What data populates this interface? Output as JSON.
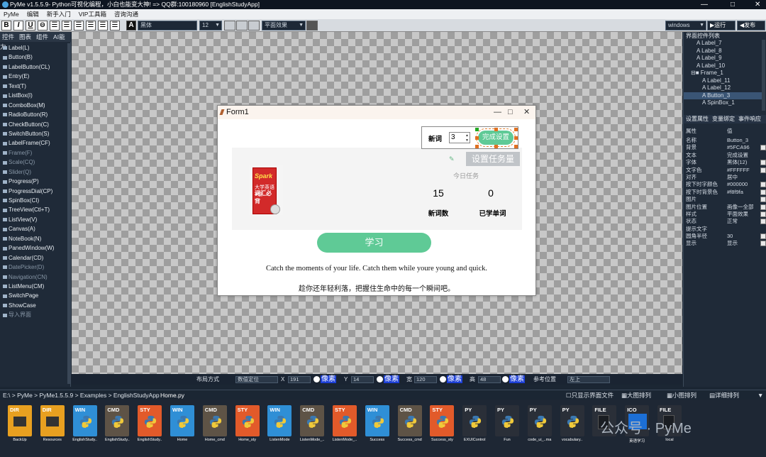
{
  "title_bar": {
    "text": "PyMe v1.5.5.9- Python可视化编程，小白也能变大神!  => QQ群:100180960    [EnglishStudyApp]"
  },
  "menu": [
    "PyMe",
    "编辑",
    "新手入门",
    "VIP工具箱",
    "咨询沟通"
  ],
  "toolbar": {
    "bold": "B",
    "italic": "I",
    "underline": "U",
    "font_color": "A",
    "font_name": "黑体",
    "font_size": "12",
    "effect": "平面效果",
    "platform": "windows",
    "run": "▶运行",
    "publish": "◀发布"
  },
  "left_panel": {
    "tabs": [
      "控件",
      "图表",
      "组件",
      "AI能力"
    ],
    "widgets": [
      "Label(L)",
      "Button(B)",
      "LabelButton(CL)",
      "Entry(E)",
      "Text(T)",
      "ListBox(I)",
      "ComboBox(M)",
      "RadioButton(R)",
      "CheckButton(C)",
      "SwitchButton(S)",
      "LabelFrame(CF)",
      "Frame(F)",
      "Scale(CQ)",
      "Slider(Q)",
      "Progress(P)",
      "ProgressDial(CP)",
      "SpinBox(CI)",
      "TreeView(Ctl+T)",
      "ListView(V)",
      "Canvas(A)",
      "NoteBook(N)",
      "PanedWindow(W)",
      "Calendar(CD)",
      "DatePicker(D)",
      "Navigation(CN)",
      "ListMenu(CM)",
      "SwitchPage",
      "ShowCase",
      "导入界面"
    ]
  },
  "form": {
    "title": "Form1",
    "new_words_label": "新词",
    "spin_value": "3",
    "done_button": "完成设置",
    "set_task_button": "设置任务量",
    "today_task": "今日任务",
    "new_count": "15",
    "learned_count": "0",
    "new_count_label": "新词数",
    "learned_label": "已学单词",
    "learn_button": "学习",
    "motto_en": "Catch the moments of your life. Catch them while youre young and quick.",
    "motto_cn": "趁你还年轻利落，把握住生命中的每一个瞬间吧。",
    "book": {
      "brand": "Spark",
      "line1": "大学英语4级",
      "line2": "词汇必背"
    }
  },
  "right_panel": {
    "tree_title": "界面控件列表",
    "tree": [
      "Label_7",
      "Label_8",
      "Label_9",
      "Label_10",
      "Frame_1",
      "Label_11",
      "Label_12",
      "Button_3",
      "SpinBox_1"
    ],
    "tabs": [
      "设置属性",
      "变量绑定",
      "事件响应"
    ],
    "props_header": {
      "key": "属性",
      "value": "值"
    },
    "props": [
      [
        "名称",
        "Button_3"
      ],
      [
        "背景",
        "#5FCA96"
      ],
      [
        "文本",
        "完成设置"
      ],
      [
        "字体",
        "黑体(12)"
      ],
      [
        "文字色",
        "#FFFFFF"
      ],
      [
        "对齐",
        "居中"
      ],
      [
        "按下时字颜色",
        "#000000"
      ],
      [
        "按下时背景色",
        "#f8f9fa"
      ],
      [
        "图片",
        ""
      ],
      [
        "图片位置",
        "画像一全部"
      ],
      [
        "样式",
        "平面效果"
      ],
      [
        "状态",
        "正常"
      ],
      [
        "提示文字",
        ""
      ],
      [
        "圆角半径",
        "30"
      ],
      [
        "显示",
        "显示"
      ]
    ]
  },
  "status": {
    "layout": "布局方式",
    "layout_mode": "数值定位",
    "x_label": "X",
    "x": "191",
    "y_label": "Y",
    "y": "14",
    "w_label": "宽",
    "w": "120",
    "h_label": "高",
    "h": "48",
    "pixel": "像素",
    "ref": "参考位置",
    "ref_val": "左上"
  },
  "path_bar": {
    "path": "E:\\ > PyMe > PyMe1.5.5.9 > Examples > EnglishStudyApp",
    "overlay": "Home.py",
    "opts": [
      "只显示界面文件",
      "大图排列",
      "小图排列",
      "详细排列"
    ]
  },
  "files": [
    {
      "tag": "DIR",
      "name": "BackUp",
      "kind": "dir"
    },
    {
      "tag": "DIR",
      "name": "Resources",
      "kind": "dir"
    },
    {
      "tag": "WIN",
      "name": "EnglishStudy..",
      "kind": "win"
    },
    {
      "tag": "CMD",
      "name": "EnglishStudy..",
      "kind": "cmd"
    },
    {
      "tag": "STY",
      "name": "EnglishStudy..",
      "kind": "sty"
    },
    {
      "tag": "WIN",
      "name": "Home",
      "kind": "win"
    },
    {
      "tag": "CMD",
      "name": "Home_cmd",
      "kind": "cmd"
    },
    {
      "tag": "STY",
      "name": "Home_sty",
      "kind": "sty"
    },
    {
      "tag": "WIN",
      "name": "ListenMode",
      "kind": "win"
    },
    {
      "tag": "CMD",
      "name": "ListenMode_..",
      "kind": "cmd"
    },
    {
      "tag": "STY",
      "name": "ListenMode_..",
      "kind": "sty"
    },
    {
      "tag": "WIN",
      "name": "Success",
      "kind": "win"
    },
    {
      "tag": "CMD",
      "name": "Success_cmd",
      "kind": "cmd"
    },
    {
      "tag": "STY",
      "name": "Success_sty",
      "kind": "sty"
    },
    {
      "tag": "PY",
      "name": "EXUIControl",
      "kind": "py"
    },
    {
      "tag": "PY",
      "name": "Fun",
      "kind": "py"
    },
    {
      "tag": "PY",
      "name": "code_ui_..ma",
      "kind": "py"
    },
    {
      "tag": "PY",
      "name": "vocabulary..",
      "kind": "py"
    },
    {
      "tag": "FILE",
      "name": "",
      "kind": "file"
    },
    {
      "tag": "ICO",
      "name": "英语学习",
      "kind": "ico"
    },
    {
      "tag": "FILE",
      "name": "local",
      "kind": "file"
    }
  ],
  "watermark": "公众号 · PyMe",
  "colors": {
    "accent": "#5FCA96",
    "dir": "#e8a020",
    "win": "#2f8fd6",
    "cmd": "#5e5346",
    "sty": "#e25a2a"
  }
}
